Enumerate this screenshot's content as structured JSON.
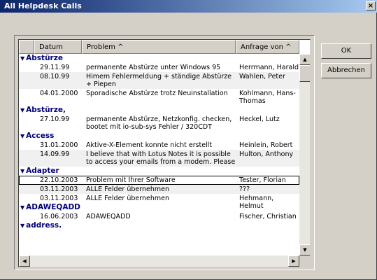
{
  "window": {
    "title": "All Helpdesk Calls",
    "close_glyph": "×"
  },
  "columns": {
    "date": "Datum",
    "problem": "Problem ^",
    "requester": "Anfrage von ^"
  },
  "buttons": {
    "ok": "OK",
    "cancel": "Abbrechen"
  },
  "groups": [
    {
      "label": "Abstürze",
      "rows": [
        {
          "date": "29.11.99",
          "problem": "permanente Abstürze unter Windows 95",
          "requester": "Herrmann, Harald"
        },
        {
          "date": "08.10.99",
          "problem": "Himem Fehlermeldung + ständige Abstürze + Piepen",
          "requester": "Wahlen, Peter"
        },
        {
          "date": "04.01.2000",
          "problem": "Sporadische Abstürze trotz Neuinstallation",
          "requester": "Kohlmann, Hans-Thomas"
        }
      ]
    },
    {
      "label": "Abstürze,",
      "rows": [
        {
          "date": "27.10.99",
          "problem": "permanente Abstürze, Netzkonfig. checken, bootet mit io-sub-sys Fehler / 320CDT",
          "requester": "Heckel, Lutz"
        }
      ]
    },
    {
      "label": "Access",
      "rows": [
        {
          "date": "31.01.2000",
          "problem": "Aktive-X-Element konnte nicht erstellt werden",
          "requester": "Heinlein, Robert"
        },
        {
          "date": "14.09.99",
          "problem": "I believe that with Lotus Notes it is possible to access your emails from a modem. Please",
          "requester": "Hulton, Anthony"
        }
      ]
    },
    {
      "label": "Adapter",
      "rows": [
        {
          "date": "22.10.2003",
          "problem": "Problem mit Ihrer Software",
          "requester": "Tester, Florian"
        },
        {
          "date": "03.11.2003",
          "problem": "ALLE Felder übernehmen",
          "requester": "???"
        },
        {
          "date": "03.11.2003",
          "problem": "ALLE Felder übernehmen",
          "requester": "Hehmann, Helmut"
        }
      ]
    },
    {
      "label": "ADAWEQADD",
      "rows": [
        {
          "date": "16.06.2003",
          "problem": "ADAWEQADD",
          "requester": "Fischer, Christian"
        }
      ]
    },
    {
      "label": "address.",
      "rows": []
    }
  ]
}
